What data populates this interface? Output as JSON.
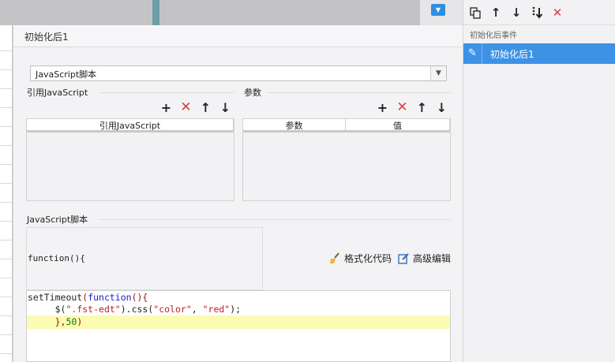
{
  "dialog": {
    "title": "初始化后1"
  },
  "script_type": {
    "selected": "JavaScript脚本"
  },
  "ref_section": {
    "title": "引用JavaScript",
    "columns": [
      "引用JavaScript"
    ]
  },
  "param_section": {
    "title": "参数",
    "columns": [
      "参数",
      "值"
    ]
  },
  "toolbar_icons": [
    "plus-icon",
    "delete-icon",
    "arrow-up-icon",
    "arrow-down-icon"
  ],
  "code_section": {
    "title": "JavaScript脚本",
    "function_header": "function(){",
    "format_button": "格式化代码",
    "advanced_button": "高级编辑"
  },
  "editor": {
    "line1": {
      "fn": "setTimeout",
      "p1": "(",
      "kw": "function",
      "p2": "(){"
    },
    "line2": {
      "indent": "     ",
      "a": "$(",
      "str": "\".fst-edt\"",
      "b": ").css(",
      "s1": "\"color\"",
      "c": ", ",
      "s2": "\"red\"",
      "d": ");"
    },
    "line3": {
      "indent": "     ",
      "a": "},",
      "num": "50",
      "b": ")"
    }
  },
  "right_panel": {
    "header": "初始化后事件",
    "selected_event": "初始化后1"
  },
  "colors": {
    "accent": "#3d92e5",
    "delete": "#e03a3a",
    "highlight": "#fbfbb2"
  }
}
